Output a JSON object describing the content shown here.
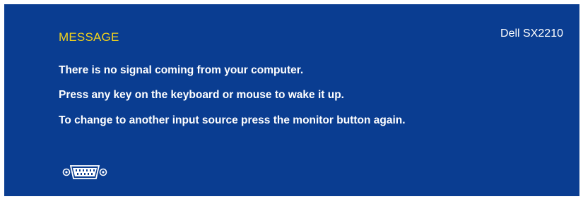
{
  "osd": {
    "heading": "MESSAGE",
    "model": "Dell SX2210",
    "lines": [
      "There is no signal coming from your computer.",
      "Press any key on the keyboard or mouse to wake it up.",
      "To change to another input source press the monitor button again."
    ],
    "input_icon": "vga-connector-icon"
  },
  "colors": {
    "background": "#0a3d91",
    "heading": "#f2d21b",
    "text": "#ffffff"
  }
}
